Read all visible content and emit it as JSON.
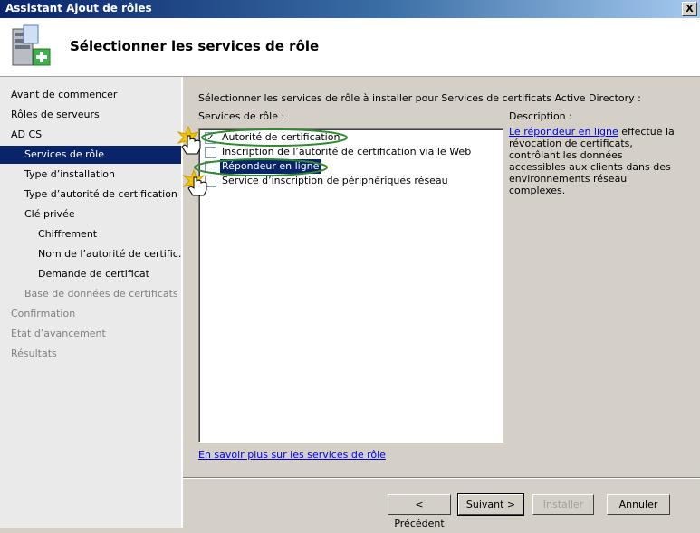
{
  "window": {
    "title": "Assistant Ajout de rôles",
    "close_label": "X"
  },
  "header": {
    "page_title": "Sélectionner les services de rôle"
  },
  "nav": {
    "items": [
      {
        "label": "Avant de commencer"
      },
      {
        "label": "Rôles de serveurs"
      },
      {
        "label": "AD CS"
      },
      {
        "label": "Services de rôle"
      },
      {
        "label": "Type d’installation"
      },
      {
        "label": "Type d’autorité de certification"
      },
      {
        "label": "Clé privée"
      },
      {
        "label": "Chiffrement"
      },
      {
        "label": "Nom de l’autorité de certific…"
      },
      {
        "label": "Demande de certificat"
      },
      {
        "label": "Base de données de certificats"
      },
      {
        "label": "Confirmation"
      },
      {
        "label": "État d’avancement"
      },
      {
        "label": "Résultats"
      }
    ]
  },
  "main": {
    "intro": "Sélectionner les services de rôle à installer pour Services de certificats Active Directory :",
    "services_label": "Services de rôle :",
    "services": [
      {
        "label": "Autorité de certification",
        "checked": true
      },
      {
        "label": "Inscription de l’autorité de certification via le Web",
        "checked": false
      },
      {
        "label": "Répondeur en ligne",
        "checked": false
      },
      {
        "label": "Service d’inscription de périphériques réseau",
        "checked": false
      }
    ],
    "description_label": "Description :",
    "description_link": "Le répondeur en ligne",
    "description_text": " effectue la révocation de certificats, contrôlant les données accessibles aux clients dans des environnements réseau complexes.",
    "learn_more": "En savoir plus sur les services de rôle"
  },
  "footer": {
    "previous": "< Précédent",
    "next": "Suivant >",
    "install": "Installer",
    "cancel": "Annuler"
  },
  "colors": {
    "selection": "#0a246a",
    "annotation_ellipse": "#2e8b2e",
    "highlight_star": "#f5c400"
  }
}
